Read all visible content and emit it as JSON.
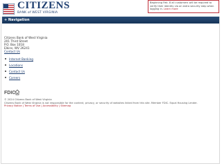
{
  "header": {
    "brand": "CITIZENS",
    "tagline": "BANK of WEST VIRGINIA",
    "notice_text": "Beginning Feb. 8 all customers will be required to verify their identity via an extra security step when logging in.",
    "notice_link": "Learn more",
    "colors": {
      "brand_blue": "#1f3f70",
      "brand_red": "#c0303a"
    }
  },
  "nav": {
    "toggle_label": "+ Navigation"
  },
  "address": {
    "line1": "Citizens Bank of West Virginia",
    "line2": "201 Third Street",
    "line3": "P.O. Box 1018",
    "line4": "Elkins, WV 26241",
    "contact_link": "Contact Us"
  },
  "links": [
    {
      "label": "Internet Banking"
    },
    {
      "label": "Locations"
    },
    {
      "label": "Contact Us"
    },
    {
      "label": "Careers"
    }
  ],
  "footer": {
    "copyright": "© 2024 Citizens Bank of West Virginia",
    "disclaimer": "Citizens Bank of West Virginia is not responsible for the content, privacy, or security of websites linked from this site. Member FDIC. Equal Housing Lender.",
    "bottom_links": "Privacy Notice | Terms of Use | Accessibility | Sitemap"
  }
}
